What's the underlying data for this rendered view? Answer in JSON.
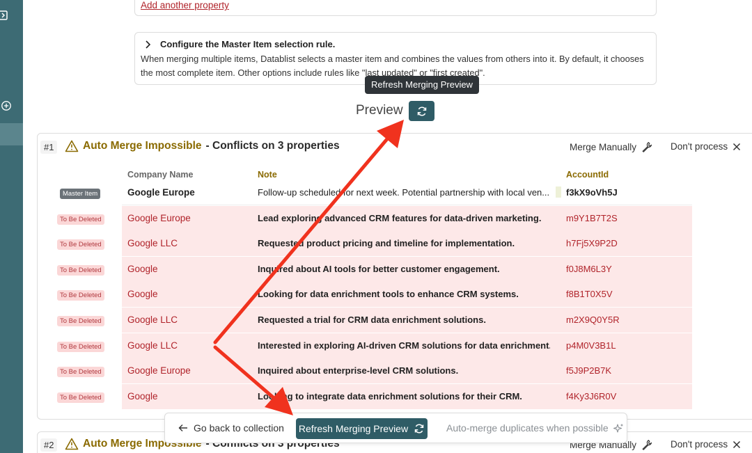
{
  "property_card": {
    "add_property_label": "Add another property"
  },
  "master_rule": {
    "heading": "Configure the Master Item selection rule.",
    "description": "When merging multiple items, Datablist selects a master item and combines the values from others into it. By default, it chooses the most complete item. Other options include rules like \"last updated\" or \"first created\"."
  },
  "tooltip": {
    "text": "Refresh Merging Preview"
  },
  "preview": {
    "label": "Preview"
  },
  "columns": {
    "company": "Company Name",
    "note": "Note",
    "account": "AccountId"
  },
  "groups": [
    {
      "number": "#1",
      "warning": "Auto Merge Impossible",
      "conflicts": "- Conflicts on 3 properties",
      "merge_manually": "Merge Manually",
      "dont_process": "Don't process",
      "rows": [
        {
          "badge": "Master Item",
          "company": "Google Europe",
          "note": "Follow-up scheduled for next week. Potential partnership with local ven...",
          "account": "f3kX9oVh5J"
        },
        {
          "badge": "To Be Deleted",
          "company": "Google Europe",
          "note": "Lead exploring advanced CRM features for data-driven marketing.",
          "account": "m9Y1B7T2S"
        },
        {
          "badge": "To Be Deleted",
          "company": "Google LLC",
          "note": "Requested product pricing and timeline for implementation.",
          "account": "h7Fj5X9P2D"
        },
        {
          "badge": "To Be Deleted",
          "company": "Google",
          "note": "Inquired about AI tools for better customer engagement.",
          "account": "f0J8M6L3Y"
        },
        {
          "badge": "To Be Deleted",
          "company": "Google",
          "note": "Looking for data enrichment tools to enhance CRM systems.",
          "account": "f8B1T0X5V"
        },
        {
          "badge": "To Be Deleted",
          "company": "Google LLC",
          "note": "Requested a trial for CRM data enrichment solutions.",
          "account": "m2X9Q0Y5R"
        },
        {
          "badge": "To Be Deleted",
          "company": "Google LLC",
          "note": "Interested in exploring AI-driven CRM solutions for data enrichment.",
          "account": "p4M0V3B1L"
        },
        {
          "badge": "To Be Deleted",
          "company": "Google Europe",
          "note": "Inquired about enterprise-level CRM solutions.",
          "account": "f5J9P2B7K"
        },
        {
          "badge": "To Be Deleted",
          "company": "Google",
          "note": "Looking to integrate data enrichment solutions for their CRM.",
          "account": "f4Ky3J6R0V"
        }
      ]
    },
    {
      "number": "#2",
      "warning": "Auto Merge Impossible",
      "conflicts": "- Conflicts on 3 properties",
      "merge_manually": "Merge Manually",
      "dont_process": "Don't process"
    }
  ],
  "bottom_bar": {
    "back_label": "Go back to collection",
    "refresh_label": "Refresh Merging Preview",
    "auto_label": "Auto-merge duplicates when possible"
  },
  "colors": {
    "teal": "#2f5c66",
    "sidebar": "#3d6b74",
    "danger": "#b0232a",
    "arrow": "#f0321e"
  }
}
